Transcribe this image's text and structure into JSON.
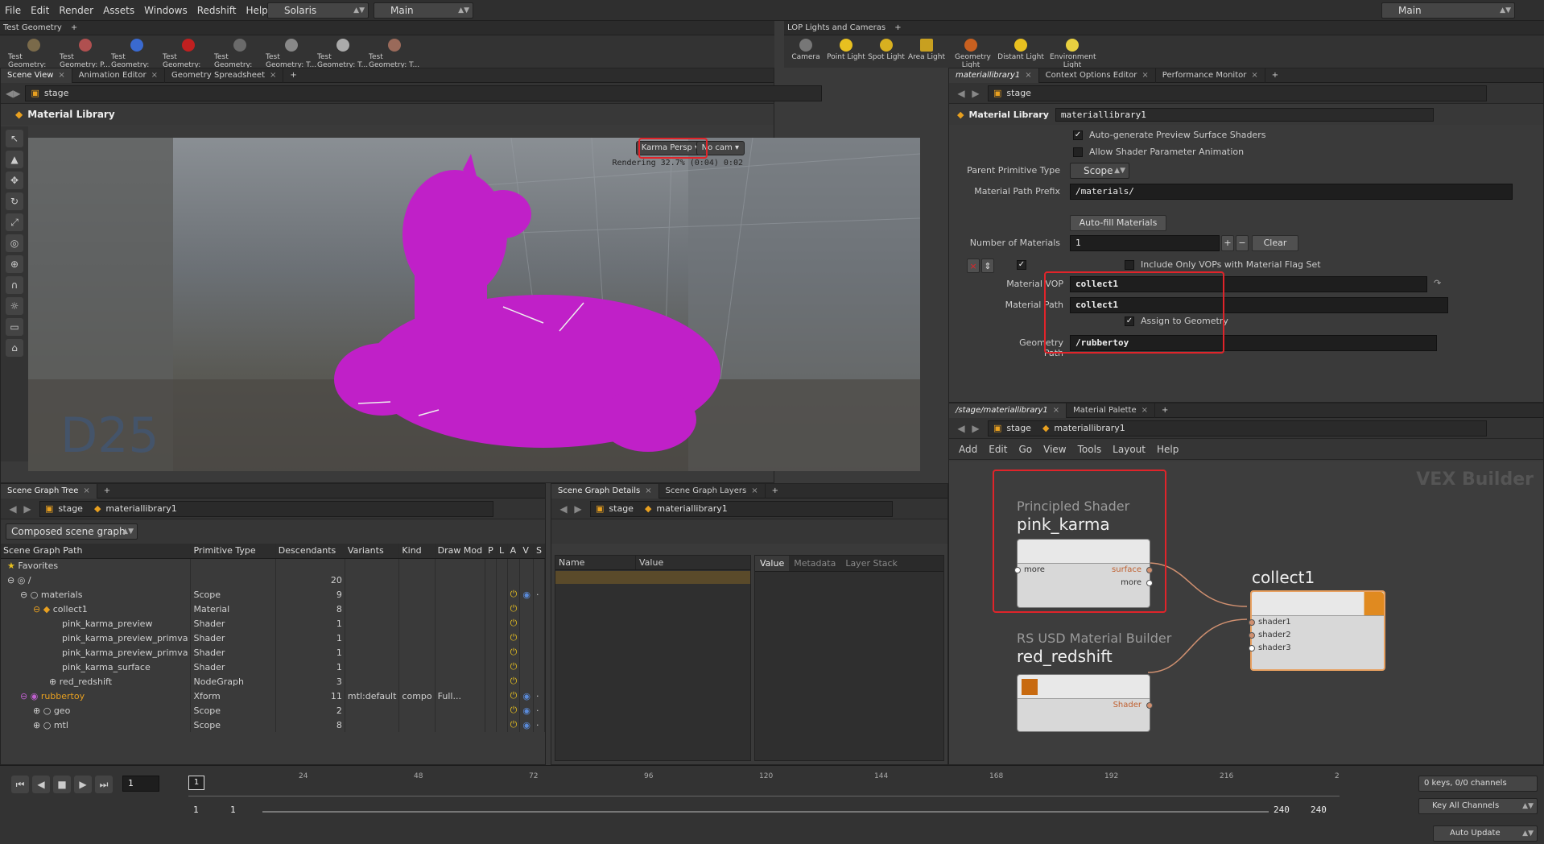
{
  "menubar": {
    "items": [
      "File",
      "Edit",
      "Render",
      "Assets",
      "Windows",
      "Redshift",
      "Help"
    ],
    "desktop": "Solaris",
    "context": "Main",
    "right_desktop": "Main"
  },
  "shelf_left": {
    "tab": "Test Geometry",
    "tools": [
      "Test Geometry: C...",
      "Test Geometry: P...",
      "Test Geometry: R...",
      "Test Geometry: S...",
      "Test Geometry: S...",
      "Test Geometry: T...",
      "Test Geometry: T...",
      "Test Geometry: T..."
    ]
  },
  "shelf_right": {
    "tab": "LOP Lights and Cameras",
    "tools": [
      "Camera",
      "Point Light",
      "Spot Light",
      "Area Light",
      "Geometry Light",
      "Distant Light",
      "Environment Light"
    ]
  },
  "viewport": {
    "tabs": [
      "Scene View",
      "Animation Editor",
      "Geometry Spreadsheet"
    ],
    "path": "stage",
    "title": "Material Library",
    "camera_menu": "Karma Persp",
    "cam_menu": "No cam",
    "render_status": "Rendering  32.7%  (0:04)  0:02"
  },
  "params": {
    "tabs": [
      "materiallibrary1",
      "Context Options Editor",
      "Performance Monitor"
    ],
    "path": "stage",
    "node_type": "Material Library",
    "node_name": "materiallibrary1",
    "auto_preview": "Auto-generate Preview Surface Shaders",
    "allow_anim": "Allow Shader Parameter Animation",
    "parent_prim_label": "Parent Primitive Type",
    "parent_prim_value": "Scope",
    "prefix_label": "Material Path Prefix",
    "prefix_value": "/materials/",
    "autofill": "Auto-fill Materials",
    "num_label": "Number of Materials",
    "num_value": "1",
    "clear": "Clear",
    "include_vops": "Include Only VOPs with Material Flag Set",
    "vop_label": "Material VOP",
    "vop_value": "collect1",
    "path_label": "Material Path",
    "path_value": "collect1",
    "assign": "Assign to Geometry",
    "geo_label": "Geometry Path",
    "geo_value": "/rubbertoy"
  },
  "network": {
    "tabs": [
      "/stage/materiallibrary1",
      "Material Palette"
    ],
    "path_root": "stage",
    "path_node": "materiallibrary1",
    "menu": [
      "Add",
      "Edit",
      "Go",
      "View",
      "Tools",
      "Layout",
      "Help"
    ],
    "watermark": "VEX Builder",
    "node1": {
      "type": "Principled Shader",
      "name": "pink_karma",
      "in": "more",
      "out1": "surface",
      "out2": "more"
    },
    "node2": {
      "type": "RS USD Material Builder",
      "name": "red_redshift",
      "out": "Shader"
    },
    "node3": {
      "name": "collect1",
      "inputs": [
        "shader1",
        "shader2",
        "shader3"
      ]
    }
  },
  "scene_tree": {
    "tabs": [
      "Scene Graph Tree"
    ],
    "path_root": "stage",
    "path_node": "materiallibrary1",
    "mode": "Composed scene graph",
    "columns": [
      "Scene Graph Path",
      "Primitive Type",
      "Descendants",
      "Variants",
      "Kind",
      "Draw Mod",
      "P",
      "L",
      "A",
      "V",
      "S"
    ],
    "favorites": "Favorites",
    "rows": [
      {
        "name": "/",
        "type": "",
        "desc": "20",
        "variants": "",
        "kind": "",
        "draw": ""
      },
      {
        "name": "materials",
        "type": "Scope",
        "desc": "9",
        "variants": "",
        "kind": "",
        "draw": ""
      },
      {
        "name": "collect1",
        "type": "Material",
        "desc": "8",
        "variants": "",
        "kind": "",
        "draw": ""
      },
      {
        "name": "pink_karma_preview",
        "type": "Shader",
        "desc": "1",
        "variants": "",
        "kind": "",
        "draw": ""
      },
      {
        "name": "pink_karma_preview_primva",
        "type": "Shader",
        "desc": "1",
        "variants": "",
        "kind": "",
        "draw": ""
      },
      {
        "name": "pink_karma_preview_primva",
        "type": "Shader",
        "desc": "1",
        "variants": "",
        "kind": "",
        "draw": ""
      },
      {
        "name": "pink_karma_surface",
        "type": "Shader",
        "desc": "1",
        "variants": "",
        "kind": "",
        "draw": ""
      },
      {
        "name": "red_redshift",
        "type": "NodeGraph",
        "desc": "3",
        "variants": "",
        "kind": "",
        "draw": ""
      },
      {
        "name": "rubbertoy",
        "type": "Xform",
        "desc": "11",
        "variants": "mtl:default",
        "kind": "compo",
        "draw": "Full..."
      },
      {
        "name": "geo",
        "type": "Scope",
        "desc": "2",
        "variants": "",
        "kind": "",
        "draw": ""
      },
      {
        "name": "mtl",
        "type": "Scope",
        "desc": "8",
        "variants": "",
        "kind": "",
        "draw": ""
      }
    ]
  },
  "details": {
    "tabs": [
      "Scene Graph Details",
      "Scene Graph Layers"
    ],
    "path_root": "stage",
    "path_node": "materiallibrary1",
    "col_name": "Name",
    "col_value": "Value",
    "right_tabs": [
      "Value",
      "Metadata",
      "Layer Stack"
    ]
  },
  "timeline": {
    "frame": "1",
    "ticks": [
      "24",
      "48",
      "72",
      "96",
      "120",
      "144",
      "168",
      "192",
      "216",
      "2"
    ],
    "start": "1",
    "start2": "1",
    "end": "240",
    "end2": "240",
    "keys": "0 keys, 0/0 channels",
    "key_all": "Key All Channels",
    "auto_update": "Auto Update"
  },
  "colors": {
    "accent": "#e8c020",
    "highlight": "#e0242a",
    "toy": "#c020c8"
  }
}
